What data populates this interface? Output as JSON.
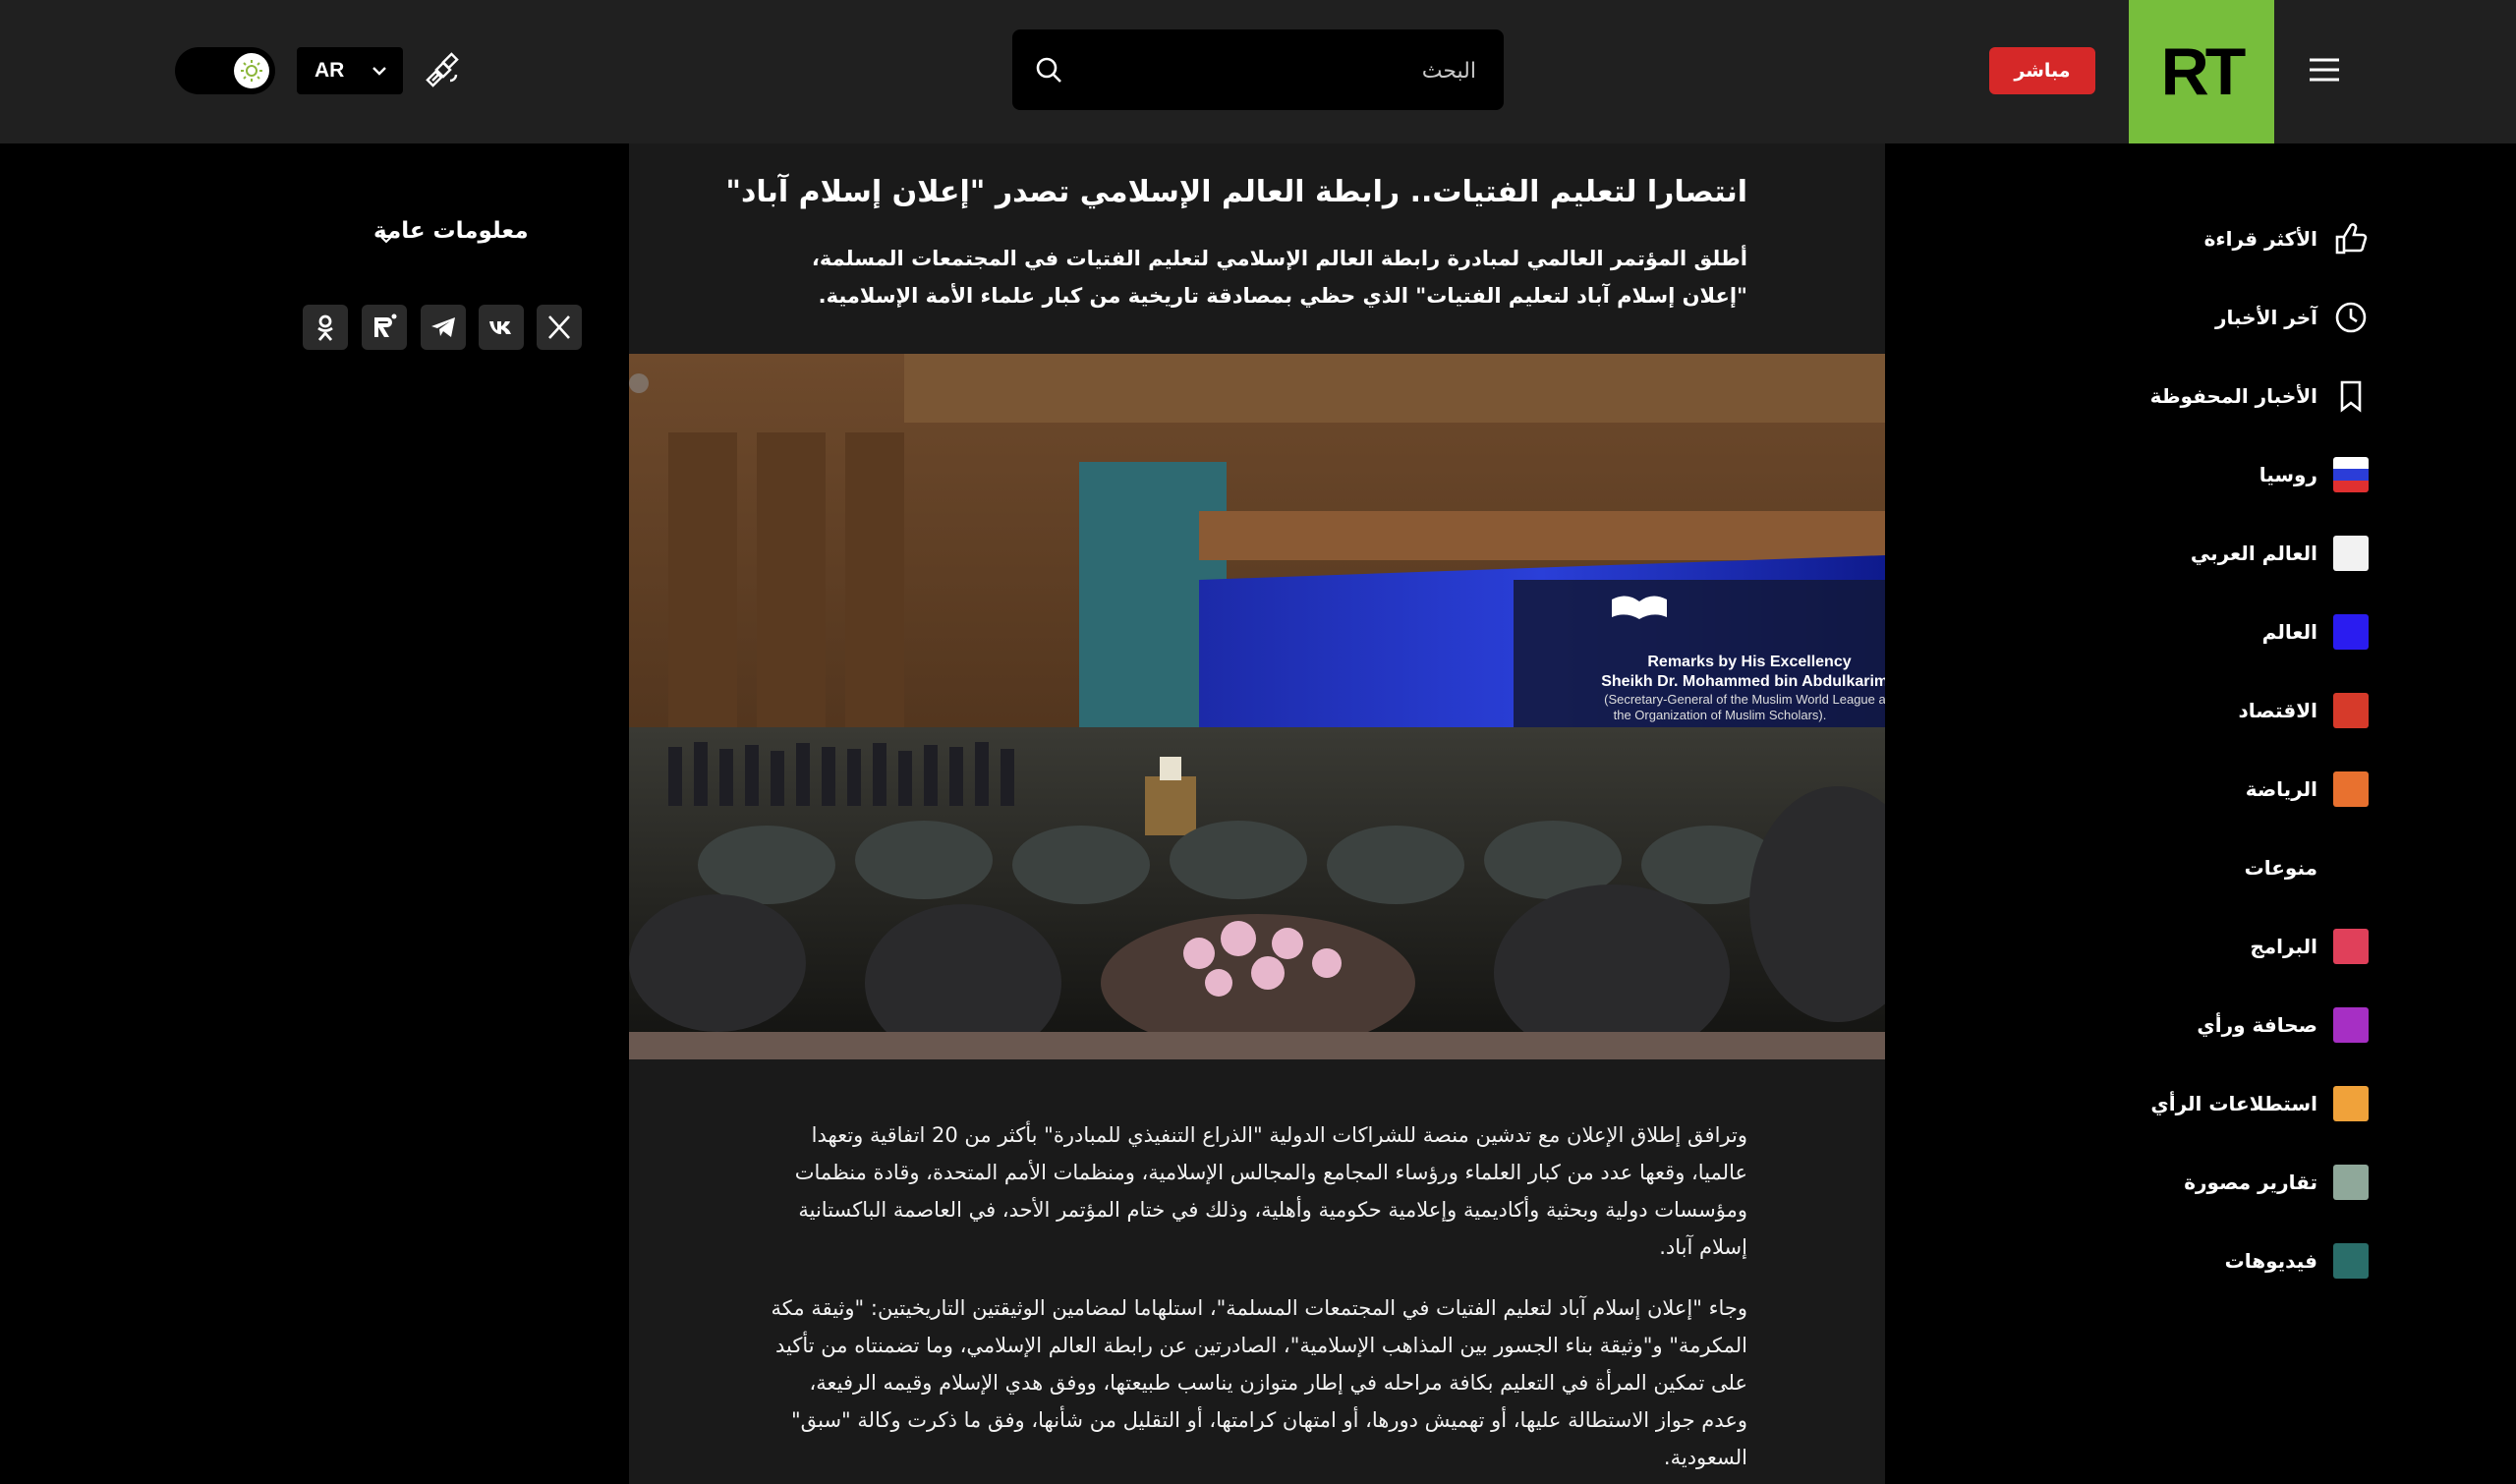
{
  "header": {
    "language": "AR",
    "search_placeholder": "البحث",
    "live_label": "مباشر",
    "logo_text": "RT"
  },
  "sidebar": {
    "items": [
      {
        "label": "الأكثر قراءة",
        "icon": "thumbs-up-icon"
      },
      {
        "label": "آخر الأخبار",
        "icon": "clock-icon"
      },
      {
        "label": "الأخبار المحفوظة",
        "icon": "bookmark-icon"
      },
      {
        "label": "روسيا",
        "color": "flag"
      },
      {
        "label": "العالم العربي",
        "color": "#f2f2f2"
      },
      {
        "label": "العالم",
        "color": "#2a1cf0"
      },
      {
        "label": "الاقتصاد",
        "color": "#d63a2a"
      },
      {
        "label": "الرياضة",
        "color": "#e8712f"
      },
      {
        "label": "منوعات",
        "color": "none"
      },
      {
        "label": "البرامج",
        "color": "#e0405a"
      },
      {
        "label": "صحافة ورأي",
        "color": "#a62fc4"
      },
      {
        "label": "استطلاعات الرأي",
        "color": "#f0a23a"
      },
      {
        "label": "تقارير مصورة",
        "color": "#8fa89a"
      },
      {
        "label": "فيديوهات",
        "color": "#2a6e6a"
      }
    ]
  },
  "left": {
    "info_label": "معلومات عامة",
    "socials": [
      "x-icon",
      "vk-icon",
      "telegram-icon",
      "rutube-icon",
      "odnoklassniki-icon"
    ]
  },
  "article": {
    "title": "انتصارا لتعليم الفتيات.. رابطة العالم الإسلامي تصدر \"إعلان إسلام آباد\"",
    "lead": "أطلق المؤتمر العالمي لمبادرة رابطة العالم الإسلامي لتعليم الفتيات في المجتمعات المسلمة، \"إعلان إسلام آباد لتعليم الفتيات\" الذي حظي بمصادقة تاريخية من كبار علماء الأمة الإسلامية.",
    "screen_line1": "Remarks by His Excellency",
    "screen_line2": "Sheikh Dr. Mohammed bin Abdulkarim Al-I",
    "screen_line3": "(Secretary-General of the Muslim World League and Chair",
    "screen_line4": "the Organization of Muslim Scholars).",
    "paragraphs": [
      "وترافق إطلاق الإعلان مع تدشين منصة للشراكات الدولية \"الذراع التنفيذي للمبادرة\" بأكثر من 20 اتفاقية وتعهدا عالميا، وقعها عدد من كبار العلماء ورؤساء المجامع والمجالس الإسلامية، ومنظمات الأمم المتحدة، وقادة منظمات ومؤسسات دولية وبحثية وأكاديمية وإعلامية حكومية وأهلية، وذلك في ختام المؤتمر الأحد، في العاصمة الباكستانية إسلام آباد.",
      "وجاء \"إعلان إسلام آباد لتعليم الفتيات في المجتمعات المسلمة\"، استلهاما لمضامين الوثيقتين التاريخيتين: \"وثيقة مكة المكرمة\" و\"وثيقة بناء الجسور بين المذاهب الإسلامية\"، الصادرتين عن رابطة العالم الإسلامي، وما تضمنتاه من تأكيد على تمكين المرأة في التعليم بكافة مراحله في إطار متوازن يناسب طبيعتها، ووفق هدي الإسلام وقيمه الرفيعة، وعدم جواز الاستطالة عليها، أو تهميش دورها، أو امتهان كرامتها، أو التقليل من شأنها، وفق ما ذكرت وكالة \"سبق\" السعودية."
    ]
  }
}
